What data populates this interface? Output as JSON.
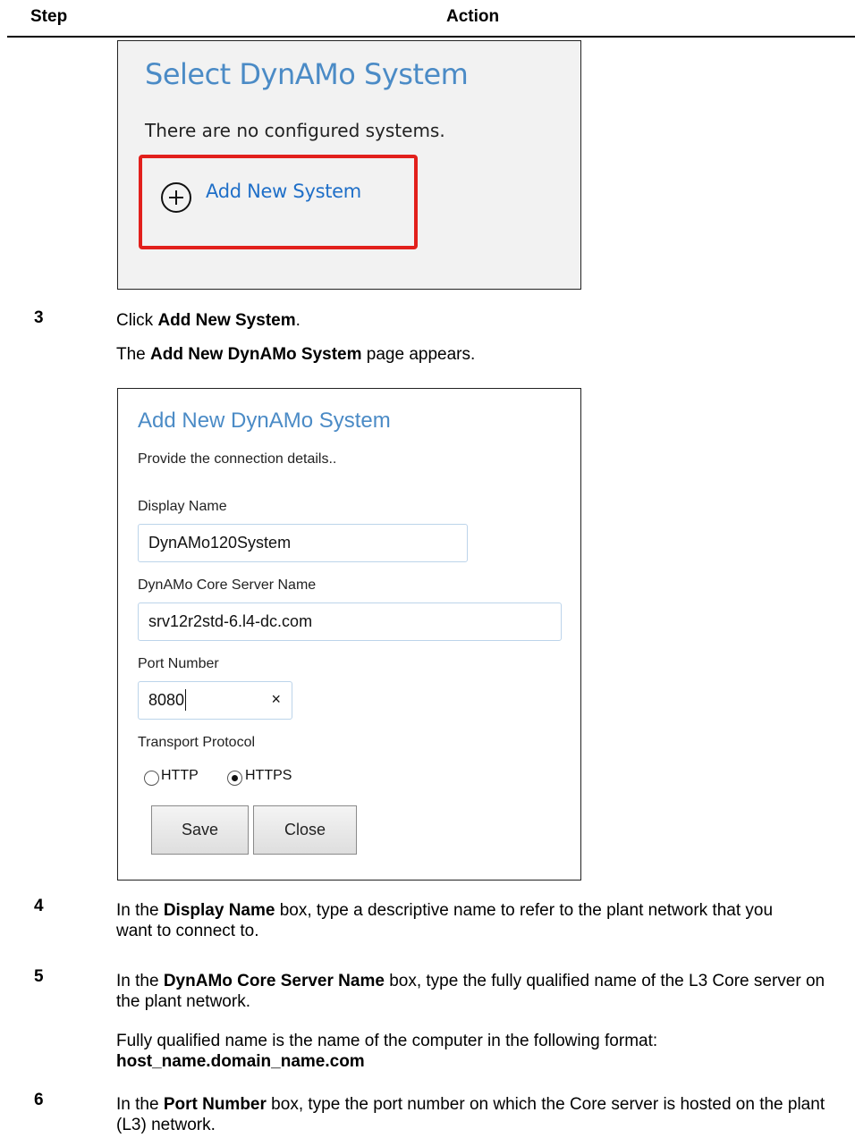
{
  "header": {
    "step": "Step",
    "action": "Action"
  },
  "select_system": {
    "title": "Select DynAMo System",
    "message": "There are no configured systems.",
    "add_new_label": "Add New System",
    "add_new_icon": "plus-circle-icon",
    "highlight_color": "#e2201c"
  },
  "step3": {
    "number": "3",
    "line1_pre": "Click ",
    "line1_bold": "Add New System",
    "line1_post": ".",
    "line2_pre": "The ",
    "line2_bold": "Add New DynAMo System",
    "line2_post": " page appears."
  },
  "add_system_form": {
    "title": "Add New DynAMo System",
    "subtitle": "Provide the connection details..",
    "display_name_label": "Display Name",
    "display_name_value": "DynAMo120System",
    "core_server_label": "DynAMo Core Server Name",
    "core_server_value": "srv12r2std-6.l4-dc.com",
    "port_label": "Port Number",
    "port_value": "8080",
    "clear_glyph": "×",
    "protocol_label": "Transport Protocol",
    "protocol_options": [
      "HTTP",
      "HTTPS"
    ],
    "protocol_selected": "HTTPS",
    "save_label": "Save",
    "close_label": "Close"
  },
  "step4": {
    "number": "4",
    "pre": "In the ",
    "bold": "Display Name",
    "post": " box, type a descriptive name to refer to the plant network that you want to connect to."
  },
  "step5": {
    "number": "5",
    "pre": "In the ",
    "bold": "DynAMo Core Server Name",
    "post": " box, type the fully qualified name of the L3 Core server on the plant network.",
    "note": "Fully qualified name is the name of the computer in the following format:",
    "format": "host_name.domain_name.com"
  },
  "step6": {
    "number": "6",
    "pre": "In the ",
    "bold": "Port Number",
    "post": " box, type the port number on which the Core server is hosted on the plant (L3) network."
  }
}
